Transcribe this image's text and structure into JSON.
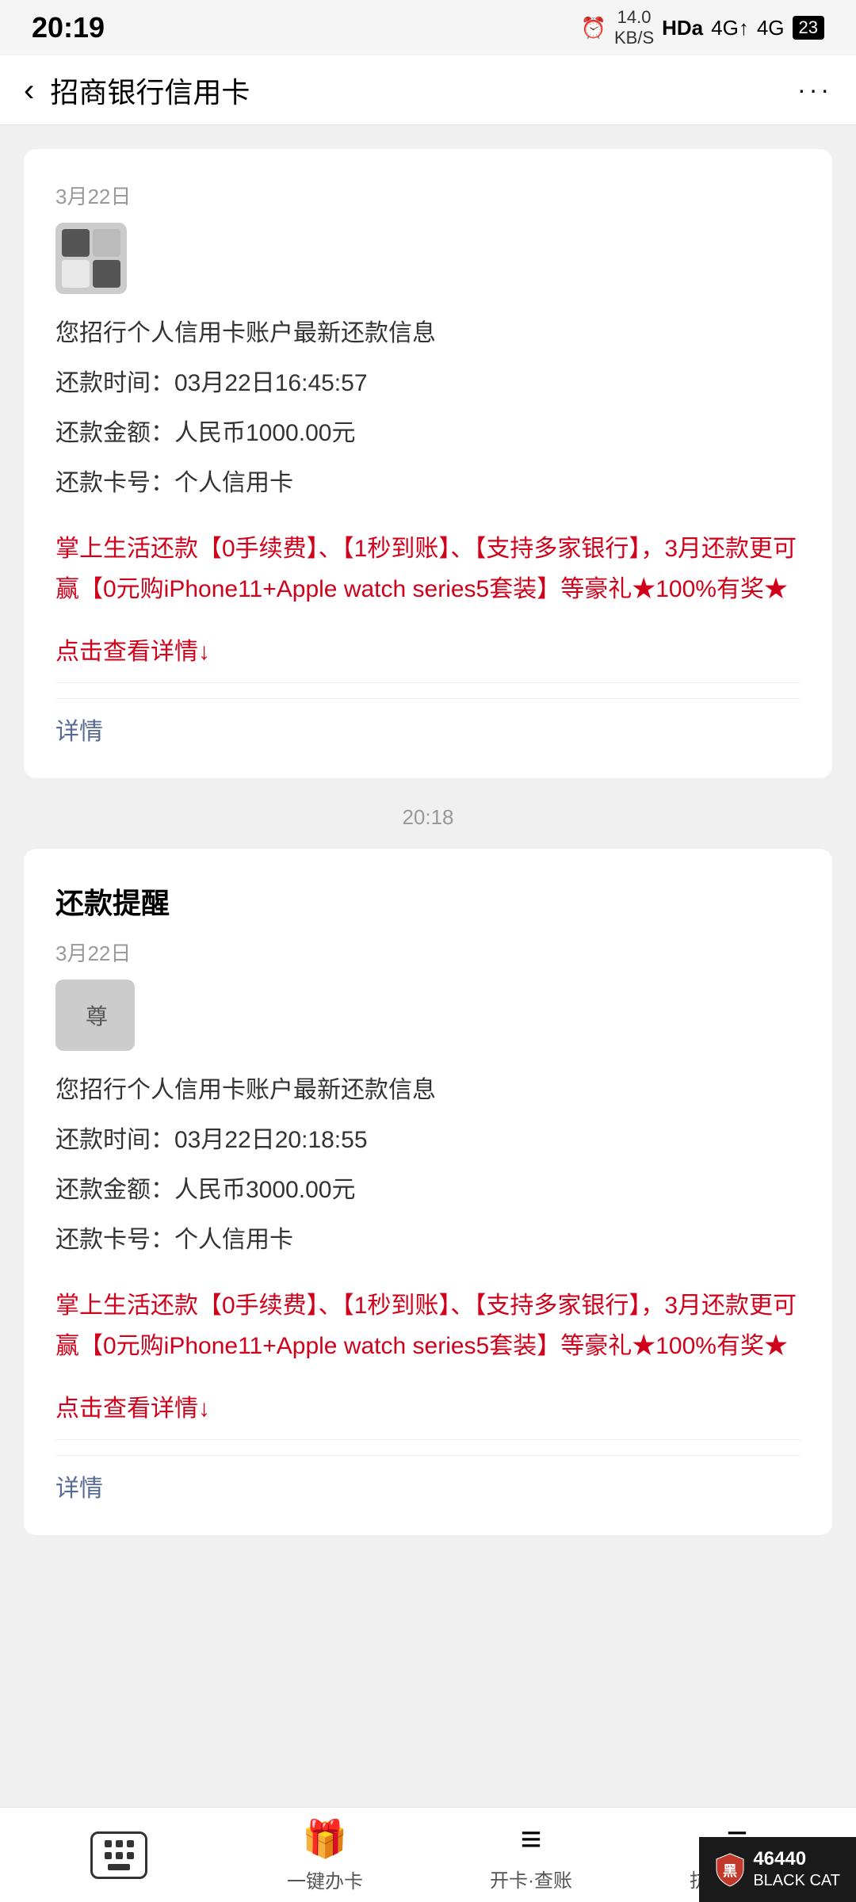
{
  "statusBar": {
    "time": "20:19",
    "alarm": "⏰",
    "speed": "14.0\nKB/S",
    "networkHD": "HDa",
    "networkSig1": "4G",
    "networkSig2": "4G",
    "battery": "23"
  },
  "header": {
    "title": "招商银行信用卡",
    "backLabel": "‹",
    "moreLabel": "···"
  },
  "messages": [
    {
      "id": "msg1",
      "dateHeader": "3月22日",
      "body": {
        "infoLines": [
          "您招行个人信用卡账户最新还款信息",
          "还款时间：03月22日16:45:57",
          "还款金额：人民币1000.00元",
          "还款卡号：个人信用卡"
        ],
        "promoText": "掌上生活还款【0手续费】、【1秒到账】、【支持多家银行】，3月还款更可赢【0元购iPhone11+Apple watch series5套装】等豪礼★100%有奖★",
        "linkText": "点击查看详情↓",
        "detailLabel": "详情"
      }
    }
  ],
  "timestamp": "20:18",
  "messages2": [
    {
      "id": "msg2",
      "cardTitle": "还款提醒",
      "dateLabel": "3月22日",
      "body": {
        "infoLines": [
          "您招行个人信用卡账户最新还款信息",
          "还款时间：03月22日20:18:55",
          "还款金额：人民币3000.00元",
          "还款卡号：个人信用卡"
        ],
        "promoText": "掌上生活还款【0手续费】、【1秒到账】、【支持多家银行】，3月还款更可赢【0元购iPhone11+Apple watch series5套装】等豪礼★100%有奖★",
        "linkText": "点击查看详情↓",
        "detailLabel": "详情"
      }
    }
  ],
  "bottomNav": {
    "keyboardLabel": "",
    "item1Label": "一键办卡",
    "item2Label": "开卡·查账",
    "item3Label": "抗疫生活圈"
  },
  "watermark": {
    "id": "46440",
    "brand": "BLACK CAT"
  }
}
